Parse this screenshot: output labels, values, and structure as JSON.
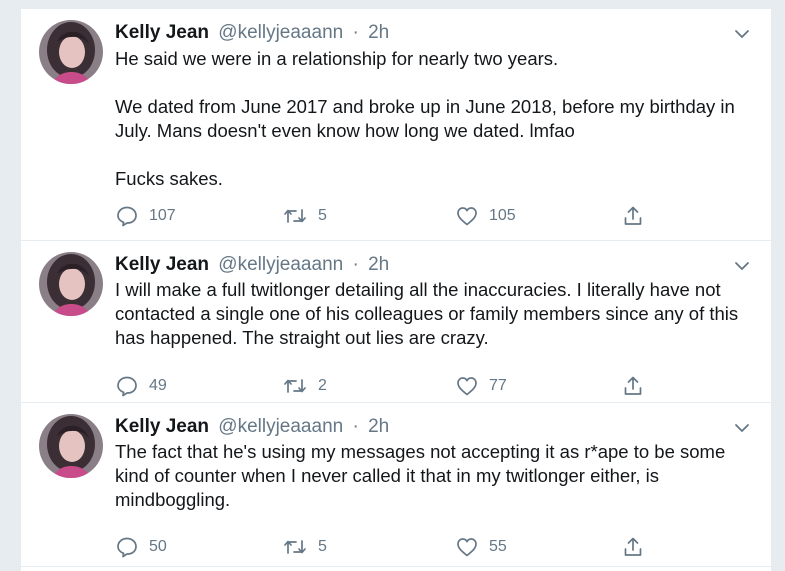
{
  "colors": {
    "text_primary": "#14171a",
    "text_secondary": "#657786",
    "background": "#e6ecf0",
    "card": "#ffffff"
  },
  "tweets": [
    {
      "author_name": "Kelly Jean",
      "handle": "@kellyjeaaann",
      "separator": "·",
      "time": "2h",
      "paragraphs": [
        "He said we were in a relationship for nearly two years.",
        "We dated from June 2017 and broke up in June 2018, before my birthday in July. Mans doesn't even know how long we dated. lmfao",
        "Fucks sakes."
      ],
      "reply_count": "107",
      "retweet_count": "5",
      "like_count": "105",
      "icons": [
        "reply-icon",
        "retweet-icon",
        "like-icon",
        "share-icon",
        "chevron-down-icon"
      ]
    },
    {
      "author_name": "Kelly Jean",
      "handle": "@kellyjeaaann",
      "separator": "·",
      "time": "2h",
      "paragraphs": [
        "I will make a full twitlonger detailing all the inaccuracies. I literally have not contacted a single one of his colleagues or family members since any of this has happened. The straight out lies are crazy."
      ],
      "reply_count": "49",
      "retweet_count": "2",
      "like_count": "77",
      "icons": [
        "reply-icon",
        "retweet-icon",
        "like-icon",
        "share-icon",
        "chevron-down-icon"
      ]
    },
    {
      "author_name": "Kelly Jean",
      "handle": "@kellyjeaaann",
      "separator": "·",
      "time": "2h",
      "paragraphs": [
        "The fact that he's using my messages not accepting it as r*ape to be some kind of counter when I never called it that in my twitlonger either, is mindboggling."
      ],
      "reply_count": "50",
      "retweet_count": "5",
      "like_count": "55",
      "icons": [
        "reply-icon",
        "retweet-icon",
        "like-icon",
        "share-icon",
        "chevron-down-icon"
      ]
    }
  ]
}
